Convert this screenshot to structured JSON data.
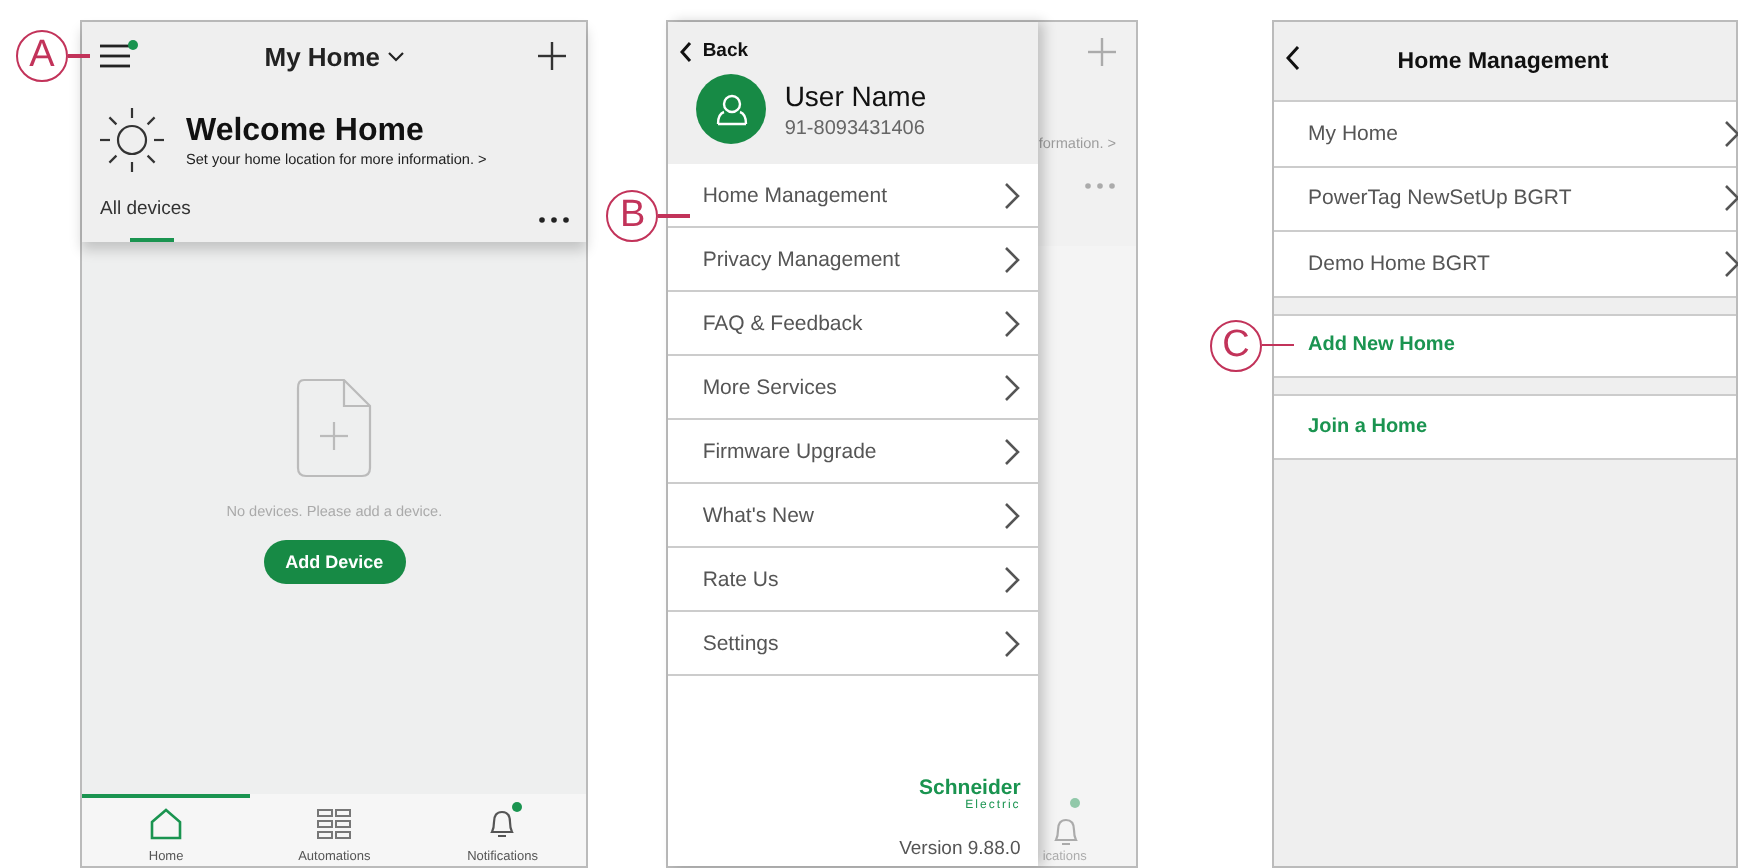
{
  "home_screen": {
    "callout": "A",
    "menu_badge": true,
    "title": "My Home",
    "welcome_title": "Welcome Home",
    "welcome_subtitle": "Set your home location for more information. >",
    "tabs": [
      {
        "label": "All devices",
        "selected": true
      }
    ],
    "empty_text": "No devices. Please add a device.",
    "add_button": "Add Device",
    "nav": [
      {
        "label": "Home",
        "selected": true,
        "badge": false
      },
      {
        "label": "Automations",
        "selected": false,
        "badge": false
      },
      {
        "label": "Notifications",
        "selected": false,
        "badge": true
      }
    ]
  },
  "menu_screen": {
    "back": "Back",
    "user_name": "User Name",
    "phone": "91-8093431406",
    "callout": "B",
    "items": [
      {
        "label": "Home Management"
      },
      {
        "label": "Privacy Management"
      },
      {
        "label": "FAQ & Feedback"
      },
      {
        "label": "More Services"
      },
      {
        "label": "Firmware Upgrade"
      },
      {
        "label": "What's New"
      },
      {
        "label": "Rate Us"
      },
      {
        "label": "Settings"
      }
    ],
    "brand": "Schneider",
    "brand_sub": "Electric",
    "version": "Version 9.88.0",
    "behind_subtitle": "formation. >",
    "behind_nav_label": "ications"
  },
  "home_management": {
    "title": "Home Management",
    "homes": [
      {
        "label": "My Home"
      },
      {
        "label": "PowerTag NewSetUp BGRT"
      },
      {
        "label": "Demo Home BGRT"
      }
    ],
    "actions": [
      {
        "label": "Add New Home",
        "callout": "C"
      },
      {
        "label": "Join a Home"
      }
    ]
  }
}
